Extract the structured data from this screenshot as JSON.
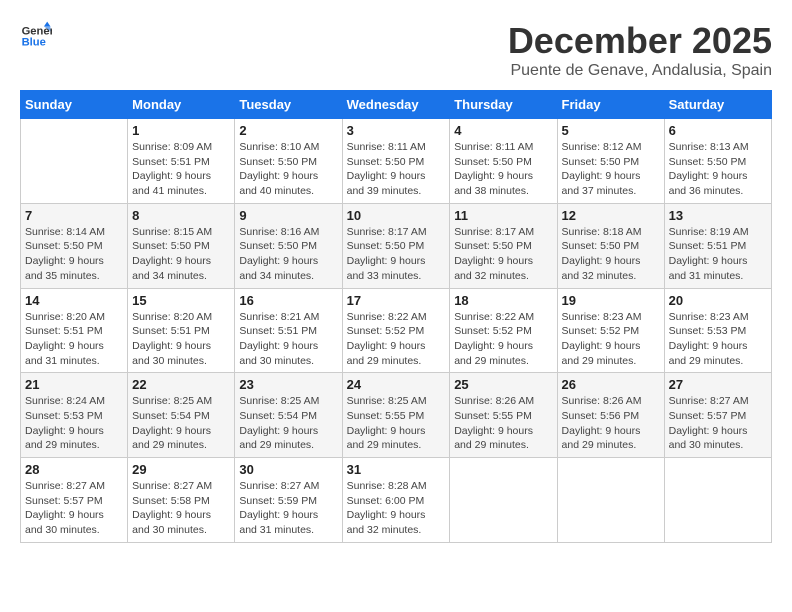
{
  "header": {
    "logo_line1": "General",
    "logo_line2": "Blue",
    "month": "December 2025",
    "location": "Puente de Genave, Andalusia, Spain"
  },
  "columns": [
    "Sunday",
    "Monday",
    "Tuesday",
    "Wednesday",
    "Thursday",
    "Friday",
    "Saturday"
  ],
  "weeks": [
    [
      {
        "day": "",
        "empty": true
      },
      {
        "day": "1",
        "sunrise": "8:09 AM",
        "sunset": "5:51 PM",
        "daylight": "9 hours and 41 minutes."
      },
      {
        "day": "2",
        "sunrise": "8:10 AM",
        "sunset": "5:50 PM",
        "daylight": "9 hours and 40 minutes."
      },
      {
        "day": "3",
        "sunrise": "8:11 AM",
        "sunset": "5:50 PM",
        "daylight": "9 hours and 39 minutes."
      },
      {
        "day": "4",
        "sunrise": "8:11 AM",
        "sunset": "5:50 PM",
        "daylight": "9 hours and 38 minutes."
      },
      {
        "day": "5",
        "sunrise": "8:12 AM",
        "sunset": "5:50 PM",
        "daylight": "9 hours and 37 minutes."
      },
      {
        "day": "6",
        "sunrise": "8:13 AM",
        "sunset": "5:50 PM",
        "daylight": "9 hours and 36 minutes."
      }
    ],
    [
      {
        "day": "7",
        "sunrise": "8:14 AM",
        "sunset": "5:50 PM",
        "daylight": "9 hours and 35 minutes."
      },
      {
        "day": "8",
        "sunrise": "8:15 AM",
        "sunset": "5:50 PM",
        "daylight": "9 hours and 34 minutes."
      },
      {
        "day": "9",
        "sunrise": "8:16 AM",
        "sunset": "5:50 PM",
        "daylight": "9 hours and 34 minutes."
      },
      {
        "day": "10",
        "sunrise": "8:17 AM",
        "sunset": "5:50 PM",
        "daylight": "9 hours and 33 minutes."
      },
      {
        "day": "11",
        "sunrise": "8:17 AM",
        "sunset": "5:50 PM",
        "daylight": "9 hours and 32 minutes."
      },
      {
        "day": "12",
        "sunrise": "8:18 AM",
        "sunset": "5:50 PM",
        "daylight": "9 hours and 32 minutes."
      },
      {
        "day": "13",
        "sunrise": "8:19 AM",
        "sunset": "5:51 PM",
        "daylight": "9 hours and 31 minutes."
      }
    ],
    [
      {
        "day": "14",
        "sunrise": "8:20 AM",
        "sunset": "5:51 PM",
        "daylight": "9 hours and 31 minutes."
      },
      {
        "day": "15",
        "sunrise": "8:20 AM",
        "sunset": "5:51 PM",
        "daylight": "9 hours and 30 minutes."
      },
      {
        "day": "16",
        "sunrise": "8:21 AM",
        "sunset": "5:51 PM",
        "daylight": "9 hours and 30 minutes."
      },
      {
        "day": "17",
        "sunrise": "8:22 AM",
        "sunset": "5:52 PM",
        "daylight": "9 hours and 29 minutes."
      },
      {
        "day": "18",
        "sunrise": "8:22 AM",
        "sunset": "5:52 PM",
        "daylight": "9 hours and 29 minutes."
      },
      {
        "day": "19",
        "sunrise": "8:23 AM",
        "sunset": "5:52 PM",
        "daylight": "9 hours and 29 minutes."
      },
      {
        "day": "20",
        "sunrise": "8:23 AM",
        "sunset": "5:53 PM",
        "daylight": "9 hours and 29 minutes."
      }
    ],
    [
      {
        "day": "21",
        "sunrise": "8:24 AM",
        "sunset": "5:53 PM",
        "daylight": "9 hours and 29 minutes."
      },
      {
        "day": "22",
        "sunrise": "8:25 AM",
        "sunset": "5:54 PM",
        "daylight": "9 hours and 29 minutes."
      },
      {
        "day": "23",
        "sunrise": "8:25 AM",
        "sunset": "5:54 PM",
        "daylight": "9 hours and 29 minutes."
      },
      {
        "day": "24",
        "sunrise": "8:25 AM",
        "sunset": "5:55 PM",
        "daylight": "9 hours and 29 minutes."
      },
      {
        "day": "25",
        "sunrise": "8:26 AM",
        "sunset": "5:55 PM",
        "daylight": "9 hours and 29 minutes."
      },
      {
        "day": "26",
        "sunrise": "8:26 AM",
        "sunset": "5:56 PM",
        "daylight": "9 hours and 29 minutes."
      },
      {
        "day": "27",
        "sunrise": "8:27 AM",
        "sunset": "5:57 PM",
        "daylight": "9 hours and 30 minutes."
      }
    ],
    [
      {
        "day": "28",
        "sunrise": "8:27 AM",
        "sunset": "5:57 PM",
        "daylight": "9 hours and 30 minutes."
      },
      {
        "day": "29",
        "sunrise": "8:27 AM",
        "sunset": "5:58 PM",
        "daylight": "9 hours and 30 minutes."
      },
      {
        "day": "30",
        "sunrise": "8:27 AM",
        "sunset": "5:59 PM",
        "daylight": "9 hours and 31 minutes."
      },
      {
        "day": "31",
        "sunrise": "8:28 AM",
        "sunset": "6:00 PM",
        "daylight": "9 hours and 32 minutes."
      },
      {
        "day": "",
        "empty": true
      },
      {
        "day": "",
        "empty": true
      },
      {
        "day": "",
        "empty": true
      }
    ]
  ]
}
